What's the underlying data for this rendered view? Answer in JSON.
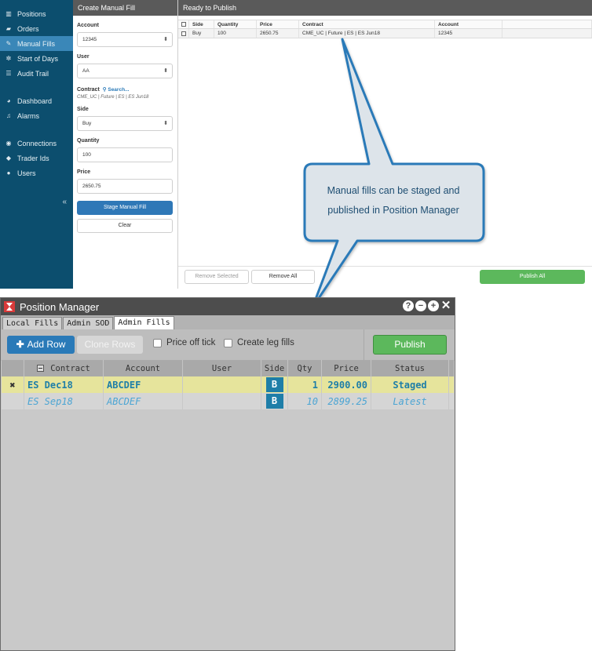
{
  "nav": {
    "items": [
      {
        "label": "Positions",
        "icon": "bar-chart-icon"
      },
      {
        "label": "Orders",
        "icon": "book-icon"
      },
      {
        "label": "Manual Fills",
        "icon": "pencil-icon"
      },
      {
        "label": "Start of Days",
        "icon": "sun-icon"
      },
      {
        "label": "Audit Trail",
        "icon": "list-icon"
      },
      {
        "label": "Dashboard",
        "icon": "dashboard-icon"
      },
      {
        "label": "Alarms",
        "icon": "bell-icon"
      },
      {
        "label": "Connections",
        "icon": "globe-icon"
      },
      {
        "label": "Trader Ids",
        "icon": "tag-icon"
      },
      {
        "label": "Users",
        "icon": "user-icon"
      }
    ],
    "collapse_glyph": "«"
  },
  "form": {
    "title": "Create Manual Fill",
    "account_label": "Account",
    "account_value": "12345",
    "user_label": "User",
    "user_value": "AA",
    "contract_label": "Contract",
    "search_link": "Search...",
    "contract_value": "CME_UC | Future | ES | ES Jun18",
    "side_label": "Side",
    "side_value": "Buy",
    "quantity_label": "Quantity",
    "quantity_value": "100",
    "price_label": "Price",
    "price_value": "2650.75",
    "stage_button": "Stage Manual Fill",
    "clear_button": "Clear"
  },
  "publish": {
    "title": "Ready to Publish",
    "columns": [
      "Side",
      "Quantity",
      "Price",
      "Contract",
      "Account"
    ],
    "rows": [
      {
        "side": "Buy",
        "quantity": "100",
        "price": "2650.75",
        "contract": "CME_UC | Future | ES | ES Jun18",
        "account": "12345"
      }
    ],
    "remove_selected": "Remove Selected",
    "remove_all": "Remove All",
    "publish_all": "Publish All"
  },
  "callout": {
    "line1": "Manual fills can be staged and",
    "line2": "published in Position Manager",
    "border_color": "#2a7ab8",
    "fill_color": "#dde4ea"
  },
  "pm": {
    "title": "Position Manager",
    "tabs": [
      "Local Fills",
      "Admin SOD",
      "Admin Fills"
    ],
    "active_tab": "Admin Fills",
    "add_row": "Add Row",
    "clone_rows": "Clone Rows",
    "price_off_tick": "Price off tick",
    "create_leg_fills": "Create leg fills",
    "publish": "Publish",
    "columns": [
      "Contract",
      "Account",
      "User",
      "Side",
      "Qty",
      "Price",
      "Status"
    ],
    "rows": [
      {
        "contract": "ES Dec18",
        "account": "ABCDEF",
        "user": "",
        "side": "B",
        "qty": "1",
        "price": "2900.00",
        "status": "Staged"
      },
      {
        "contract": "ES Sep18",
        "account": "ABCDEF",
        "user": "",
        "side": "B",
        "qty": "10",
        "price": "2899.25",
        "status": "Latest"
      }
    ]
  }
}
